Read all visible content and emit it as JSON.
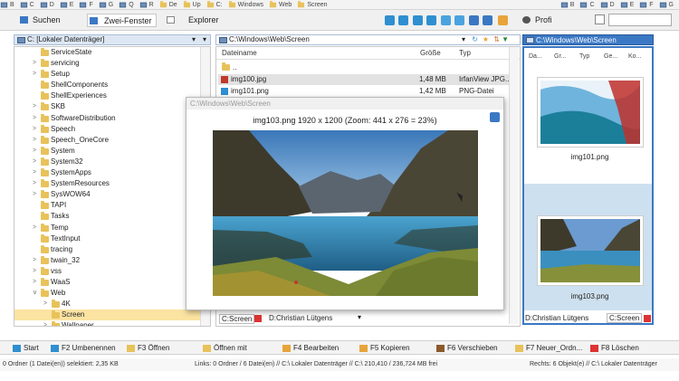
{
  "drivebar": {
    "items": [
      "B",
      "C",
      "D",
      "E",
      "F",
      "G",
      "Q",
      "R",
      "De",
      "Up",
      "C:",
      "Windows",
      "Web",
      "Screen"
    ],
    "right_items": [
      "B",
      "C",
      "D",
      "E",
      "F",
      "G"
    ]
  },
  "toolbar": {
    "search_label": "Suchen",
    "two_window_label": "Zwei-Fenster",
    "explorer_label": "Explorer",
    "profile_label": "Profi"
  },
  "left_pane": {
    "path": "C: [Lokaler Datenträger]",
    "tree": [
      {
        "label": "ServiceState",
        "level": 1,
        "expandable": false
      },
      {
        "label": "servicing",
        "level": 1,
        "expandable": true
      },
      {
        "label": "Setup",
        "level": 1,
        "expandable": true
      },
      {
        "label": "ShellComponents",
        "level": 1,
        "expandable": false
      },
      {
        "label": "ShellExperiences",
        "level": 1,
        "expandable": false
      },
      {
        "label": "SKB",
        "level": 1,
        "expandable": true
      },
      {
        "label": "SoftwareDistribution",
        "level": 1,
        "expandable": true
      },
      {
        "label": "Speech",
        "level": 1,
        "expandable": true
      },
      {
        "label": "Speech_OneCore",
        "level": 1,
        "expandable": true
      },
      {
        "label": "System",
        "level": 1,
        "expandable": true
      },
      {
        "label": "System32",
        "level": 1,
        "expandable": true
      },
      {
        "label": "SystemApps",
        "level": 1,
        "expandable": true
      },
      {
        "label": "SystemResources",
        "level": 1,
        "expandable": true
      },
      {
        "label": "SysWOW64",
        "level": 1,
        "expandable": true
      },
      {
        "label": "TAPI",
        "level": 1,
        "expandable": false
      },
      {
        "label": "Tasks",
        "level": 1,
        "expandable": false
      },
      {
        "label": "Temp",
        "level": 1,
        "expandable": true
      },
      {
        "label": "TextInput",
        "level": 1,
        "expandable": false
      },
      {
        "label": "tracing",
        "level": 1,
        "expandable": false
      },
      {
        "label": "twain_32",
        "level": 1,
        "expandable": true
      },
      {
        "label": "vss",
        "level": 1,
        "expandable": true
      },
      {
        "label": "WaaS",
        "level": 1,
        "expandable": true
      },
      {
        "label": "Web",
        "level": 1,
        "expandable": true,
        "expanded": true
      },
      {
        "label": "4K",
        "level": 2,
        "expandable": true
      },
      {
        "label": "Screen",
        "level": 2,
        "expandable": false,
        "selected": true
      },
      {
        "label": "Wallpaper",
        "level": 2,
        "expandable": true
      }
    ]
  },
  "middle_pane": {
    "path": "C:\\Windows\\Web\\Screen",
    "columns": {
      "name": "Dateiname",
      "size": "Größe",
      "type": "Typ"
    },
    "files": [
      {
        "name": "..",
        "size": "",
        "type": ""
      },
      {
        "name": "img100.jpg",
        "size": "1,48 MB",
        "type": "IrfanView JPG..."
      },
      {
        "name": "img101.png",
        "size": "1,42 MB",
        "type": "PNG-Datei"
      }
    ],
    "tabs": [
      "C:Screen",
      "D:Christian Lütgens"
    ]
  },
  "viewer": {
    "title": "C:\\Windows\\Web\\Screen",
    "caption": "img103.png 1920 x 1200 (Zoom: 441 x 276 = 23%)"
  },
  "right_pane": {
    "path": "C:\\Windows\\Web\\Screen",
    "columns": [
      "Da...",
      "Gr...",
      "Typ",
      "Ge...",
      "Ko..."
    ],
    "thumbnails": [
      {
        "label": "img101.png"
      },
      {
        "label": "img103.png"
      }
    ],
    "tabs": [
      "D:Christian Lütgens",
      "C:Screen"
    ]
  },
  "function_bar": [
    {
      "label": "Start",
      "icon": "windows-icon"
    },
    {
      "label": "F2 Umbenennen",
      "icon": "rename-icon"
    },
    {
      "label": "F3 Öffnen",
      "icon": "folder-open-icon"
    },
    {
      "label": "Öffnen mit",
      "icon": "open-with-icon"
    },
    {
      "label": "F4 Bearbeiten",
      "icon": "edit-icon"
    },
    {
      "label": "F5 Kopieren",
      "icon": "copy-icon"
    },
    {
      "label": "F6 Verschieben",
      "icon": "move-icon"
    },
    {
      "label": "F7 Neuer_Ordn...",
      "icon": "new-folder-icon"
    },
    {
      "label": "F8 Löschen",
      "icon": "delete-icon"
    }
  ],
  "status": {
    "left": "0 Ordner (1 Datei(en)) selektiert: 2,35 KB",
    "middle": "Links: 0 Ordner / 6 Datei(en) // C:\\ Lokaler Datenträger // C:\\ 210,410 / 236,724 MB frei",
    "right": "Rechts: 6 Objekt(e) // C:\\ Lokaler Datenträger"
  },
  "colors": {
    "accent": "#3b78c4",
    "folder": "#e8c25a",
    "selection": "#fbe3a1"
  }
}
